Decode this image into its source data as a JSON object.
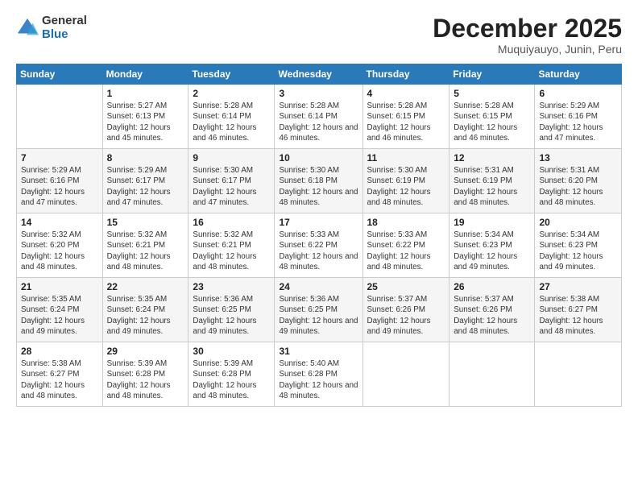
{
  "logo": {
    "general": "General",
    "blue": "Blue"
  },
  "header": {
    "month": "December 2025",
    "location": "Muquiyauyo, Junin, Peru"
  },
  "weekdays": [
    "Sunday",
    "Monday",
    "Tuesday",
    "Wednesday",
    "Thursday",
    "Friday",
    "Saturday"
  ],
  "weeks": [
    [
      {
        "day": "",
        "info": ""
      },
      {
        "day": "1",
        "info": "Sunrise: 5:27 AM\nSunset: 6:13 PM\nDaylight: 12 hours\nand 45 minutes."
      },
      {
        "day": "2",
        "info": "Sunrise: 5:28 AM\nSunset: 6:14 PM\nDaylight: 12 hours\nand 46 minutes."
      },
      {
        "day": "3",
        "info": "Sunrise: 5:28 AM\nSunset: 6:14 PM\nDaylight: 12 hours\nand 46 minutes."
      },
      {
        "day": "4",
        "info": "Sunrise: 5:28 AM\nSunset: 6:15 PM\nDaylight: 12 hours\nand 46 minutes."
      },
      {
        "day": "5",
        "info": "Sunrise: 5:28 AM\nSunset: 6:15 PM\nDaylight: 12 hours\nand 46 minutes."
      },
      {
        "day": "6",
        "info": "Sunrise: 5:29 AM\nSunset: 6:16 PM\nDaylight: 12 hours\nand 47 minutes."
      }
    ],
    [
      {
        "day": "7",
        "info": "Sunrise: 5:29 AM\nSunset: 6:16 PM\nDaylight: 12 hours\nand 47 minutes."
      },
      {
        "day": "8",
        "info": "Sunrise: 5:29 AM\nSunset: 6:17 PM\nDaylight: 12 hours\nand 47 minutes."
      },
      {
        "day": "9",
        "info": "Sunrise: 5:30 AM\nSunset: 6:17 PM\nDaylight: 12 hours\nand 47 minutes."
      },
      {
        "day": "10",
        "info": "Sunrise: 5:30 AM\nSunset: 6:18 PM\nDaylight: 12 hours\nand 48 minutes."
      },
      {
        "day": "11",
        "info": "Sunrise: 5:30 AM\nSunset: 6:19 PM\nDaylight: 12 hours\nand 48 minutes."
      },
      {
        "day": "12",
        "info": "Sunrise: 5:31 AM\nSunset: 6:19 PM\nDaylight: 12 hours\nand 48 minutes."
      },
      {
        "day": "13",
        "info": "Sunrise: 5:31 AM\nSunset: 6:20 PM\nDaylight: 12 hours\nand 48 minutes."
      }
    ],
    [
      {
        "day": "14",
        "info": "Sunrise: 5:32 AM\nSunset: 6:20 PM\nDaylight: 12 hours\nand 48 minutes."
      },
      {
        "day": "15",
        "info": "Sunrise: 5:32 AM\nSunset: 6:21 PM\nDaylight: 12 hours\nand 48 minutes."
      },
      {
        "day": "16",
        "info": "Sunrise: 5:32 AM\nSunset: 6:21 PM\nDaylight: 12 hours\nand 48 minutes."
      },
      {
        "day": "17",
        "info": "Sunrise: 5:33 AM\nSunset: 6:22 PM\nDaylight: 12 hours\nand 48 minutes."
      },
      {
        "day": "18",
        "info": "Sunrise: 5:33 AM\nSunset: 6:22 PM\nDaylight: 12 hours\nand 48 minutes."
      },
      {
        "day": "19",
        "info": "Sunrise: 5:34 AM\nSunset: 6:23 PM\nDaylight: 12 hours\nand 49 minutes."
      },
      {
        "day": "20",
        "info": "Sunrise: 5:34 AM\nSunset: 6:23 PM\nDaylight: 12 hours\nand 49 minutes."
      }
    ],
    [
      {
        "day": "21",
        "info": "Sunrise: 5:35 AM\nSunset: 6:24 PM\nDaylight: 12 hours\nand 49 minutes."
      },
      {
        "day": "22",
        "info": "Sunrise: 5:35 AM\nSunset: 6:24 PM\nDaylight: 12 hours\nand 49 minutes."
      },
      {
        "day": "23",
        "info": "Sunrise: 5:36 AM\nSunset: 6:25 PM\nDaylight: 12 hours\nand 49 minutes."
      },
      {
        "day": "24",
        "info": "Sunrise: 5:36 AM\nSunset: 6:25 PM\nDaylight: 12 hours\nand 49 minutes."
      },
      {
        "day": "25",
        "info": "Sunrise: 5:37 AM\nSunset: 6:26 PM\nDaylight: 12 hours\nand 49 minutes."
      },
      {
        "day": "26",
        "info": "Sunrise: 5:37 AM\nSunset: 6:26 PM\nDaylight: 12 hours\nand 48 minutes."
      },
      {
        "day": "27",
        "info": "Sunrise: 5:38 AM\nSunset: 6:27 PM\nDaylight: 12 hours\nand 48 minutes."
      }
    ],
    [
      {
        "day": "28",
        "info": "Sunrise: 5:38 AM\nSunset: 6:27 PM\nDaylight: 12 hours\nand 48 minutes."
      },
      {
        "day": "29",
        "info": "Sunrise: 5:39 AM\nSunset: 6:28 PM\nDaylight: 12 hours\nand 48 minutes."
      },
      {
        "day": "30",
        "info": "Sunrise: 5:39 AM\nSunset: 6:28 PM\nDaylight: 12 hours\nand 48 minutes."
      },
      {
        "day": "31",
        "info": "Sunrise: 5:40 AM\nSunset: 6:28 PM\nDaylight: 12 hours\nand 48 minutes."
      },
      {
        "day": "",
        "info": ""
      },
      {
        "day": "",
        "info": ""
      },
      {
        "day": "",
        "info": ""
      }
    ]
  ]
}
